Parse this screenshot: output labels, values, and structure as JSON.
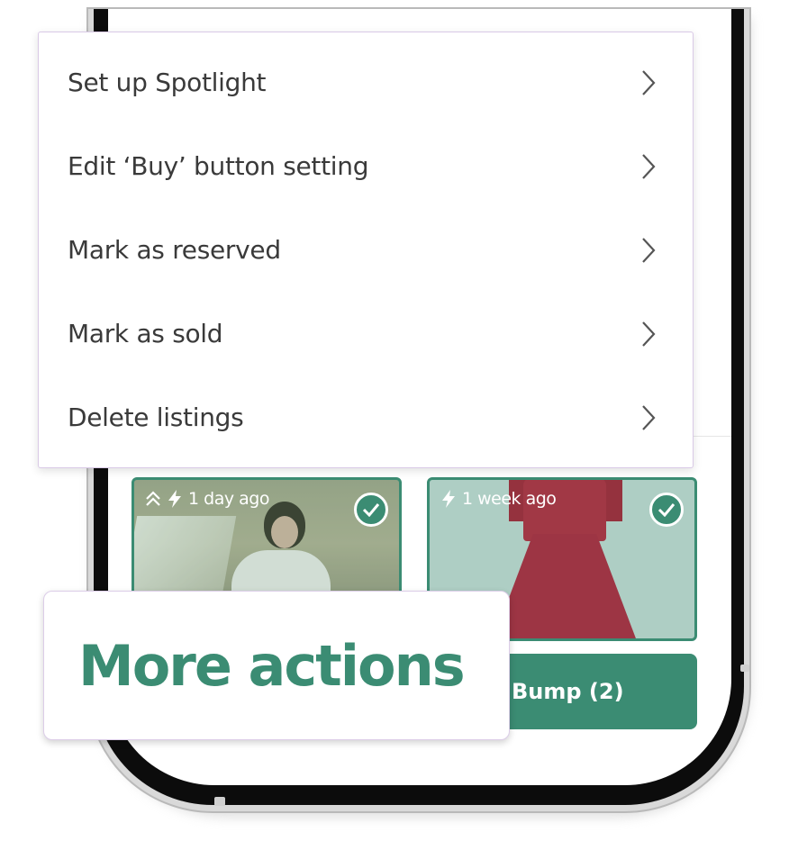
{
  "menu": {
    "items": [
      {
        "label": "Set up Spotlight"
      },
      {
        "label": "Edit ‘Buy’ button setting"
      },
      {
        "label": "Mark as reserved"
      },
      {
        "label": "Mark as sold"
      },
      {
        "label": "Delete listings"
      }
    ]
  },
  "listings": [
    {
      "time": "1 day ago",
      "icons": [
        "double-chevron-up-icon",
        "lightning-icon"
      ],
      "selected": true
    },
    {
      "time": "1 week ago",
      "icons": [
        "lightning-icon"
      ],
      "selected": true
    }
  ],
  "bump_button": {
    "label": "Bump (2)"
  },
  "callout": {
    "text": "More actions"
  },
  "colors": {
    "accent": "#3b8c73",
    "text": "#3a3a3a",
    "menu_border": "#d9c9e6"
  }
}
